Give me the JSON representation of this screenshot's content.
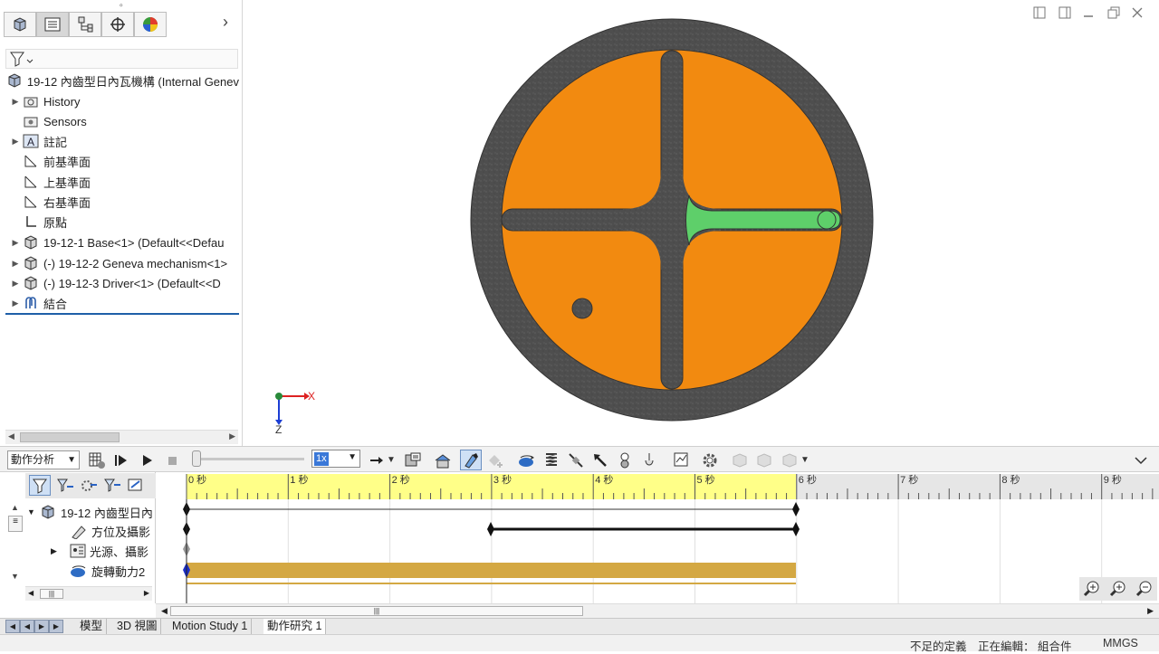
{
  "feature_tree": {
    "root_label": "19-12 內齒型日內瓦機構 (Internal Genev",
    "items": [
      {
        "label": "History",
        "icon": "history-folder-icon",
        "expandable": true
      },
      {
        "label": "Sensors",
        "icon": "sensors-icon",
        "expandable": false
      },
      {
        "label": "註記",
        "icon": "annotations-icon",
        "expandable": true
      },
      {
        "label": "前基準面",
        "icon": "plane-icon",
        "expandable": false
      },
      {
        "label": "上基準面",
        "icon": "plane-icon",
        "expandable": false
      },
      {
        "label": "右基準面",
        "icon": "plane-icon",
        "expandable": false
      },
      {
        "label": "原點",
        "icon": "origin-icon",
        "expandable": false
      },
      {
        "label": "19-12-1 Base<1> (Default<<Defau",
        "icon": "part-icon",
        "expandable": true
      },
      {
        "label": "(-) 19-12-2 Geneva mechanism<1>",
        "icon": "part-icon",
        "expandable": true
      },
      {
        "label": "(-) 19-12-3 Driver<1> (Default<<D",
        "icon": "part-icon",
        "expandable": true
      },
      {
        "label": "結合",
        "icon": "mates-icon",
        "expandable": true
      }
    ]
  },
  "viewport": {
    "axis_x": "X",
    "axis_z": "Z",
    "colors": {
      "ring": "#5a5a5a",
      "disk": "#f28a10",
      "driver": "#5ecf6a"
    }
  },
  "motion": {
    "study_type": "動作分析",
    "speed": "1x"
  },
  "timeline": {
    "ticks": [
      "0 秒",
      "1 秒",
      "2 秒",
      "3 秒",
      "4 秒",
      "5 秒",
      "6 秒",
      "7 秒",
      "8 秒",
      "9 秒"
    ],
    "rows": [
      {
        "label": "19-12 內齒型日內"
      },
      {
        "label": "方位及攝影"
      },
      {
        "label": "光源、攝影"
      },
      {
        "label": "旋轉動力2"
      }
    ]
  },
  "bottom_tabs": [
    "模型",
    "3D 視圖",
    "Motion Study 1",
    "動作研究 1"
  ],
  "status": {
    "definition": "不足的定義",
    "editing": "正在編輯： 組合件",
    "units": "MMGS"
  }
}
